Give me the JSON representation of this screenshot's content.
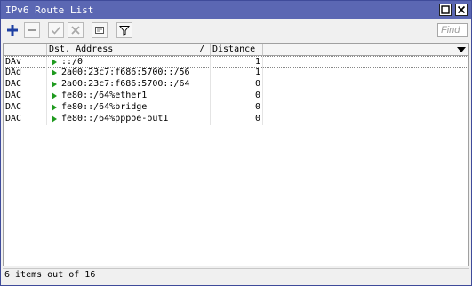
{
  "window": {
    "title": "IPv6 Route List",
    "title_bg": "#5b67b3"
  },
  "toolbar": {
    "buttons": [
      {
        "name": "add",
        "icon": "plus-icon",
        "color": "#1d3fa3"
      },
      {
        "name": "remove",
        "icon": "minus-icon"
      },
      {
        "name": "enable",
        "icon": "check-icon"
      },
      {
        "name": "disable",
        "icon": "x-icon"
      },
      {
        "name": "comment",
        "icon": "note-icon"
      },
      {
        "name": "filter",
        "icon": "filter-icon"
      }
    ],
    "find_placeholder": "Find"
  },
  "table": {
    "columns": [
      "",
      "Dst. Address",
      "Distance"
    ],
    "sort_indicator": "/",
    "rows": [
      {
        "flags": "DAv",
        "dst": "::/0",
        "distance": "1"
      },
      {
        "flags": "DAd",
        "dst": "2a00:23c7:f686:5700::/56",
        "distance": "1"
      },
      {
        "flags": "DAC",
        "dst": "2a00:23c7:f686:5700::/64",
        "distance": "0"
      },
      {
        "flags": "DAC",
        "dst": "fe80::/64%ether1",
        "distance": "0"
      },
      {
        "flags": "DAC",
        "dst": "fe80::/64%bridge",
        "distance": "0"
      },
      {
        "flags": "DAC",
        "dst": "fe80::/64%pppoe-out1",
        "distance": "0"
      }
    ],
    "route_arrow_color": "#1f9a1f"
  },
  "status": {
    "text": "6 items out of 16"
  }
}
